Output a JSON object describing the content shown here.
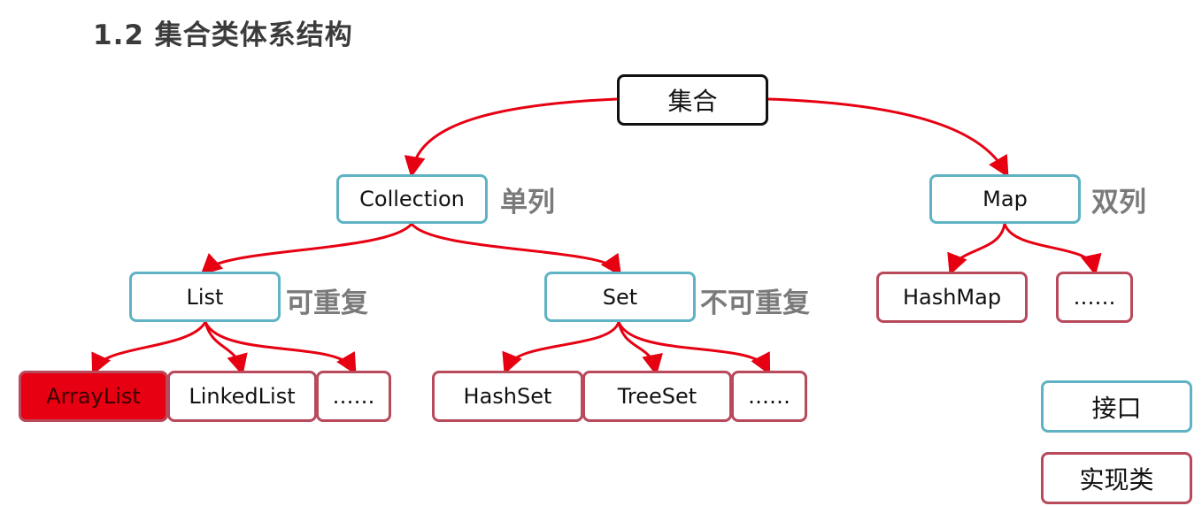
{
  "slide": {
    "title": "1.2 集合类体系结构"
  },
  "colors": {
    "interface_border": "#5fb3c4",
    "implementation_border": "#b84a5c",
    "arrow": "#e60012",
    "highlight_fill": "#e60012",
    "tag_text": "#7a7a7a"
  },
  "nodes": {
    "root": "集合",
    "collection": "Collection",
    "map": "Map",
    "list": "List",
    "set": "Set",
    "arraylist": "ArrayList",
    "linkedlist": "LinkedList",
    "list_more": "……",
    "hashset": "HashSet",
    "treeset": "TreeSet",
    "set_more": "……",
    "hashmap": "HashMap",
    "map_more": "……"
  },
  "tags": {
    "collection": "单列",
    "map": "双列",
    "list": "可重复",
    "set": "不可重复"
  },
  "legend": {
    "interface": "接口",
    "implementation": "实现类"
  },
  "highlighted_node": "ArrayList"
}
